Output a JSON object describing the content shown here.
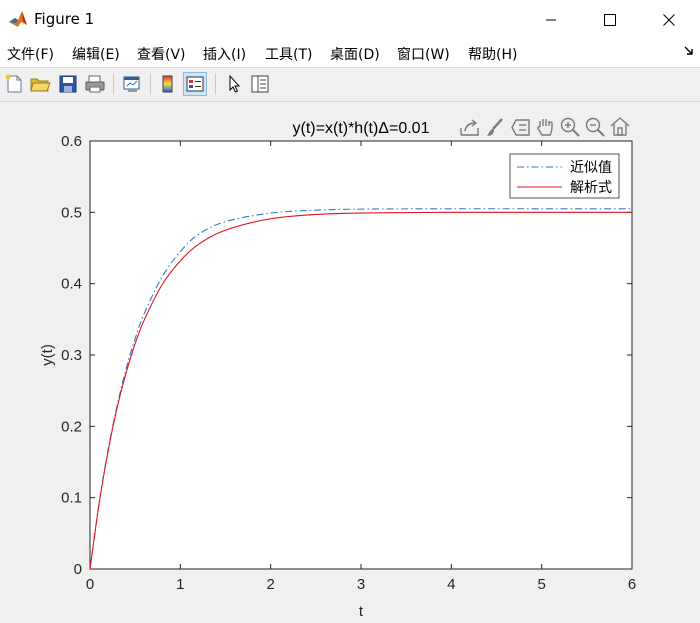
{
  "window": {
    "title": "Figure 1"
  },
  "menu": {
    "items": [
      "文件(F)",
      "编辑(E)",
      "查看(V)",
      "插入(I)",
      "工具(T)",
      "桌面(D)",
      "窗口(W)",
      "帮助(H)"
    ]
  },
  "toolbar": {
    "buttons": [
      "new-figure",
      "open-file",
      "save",
      "print",
      "link-plot",
      "insert-colorbar",
      "insert-legend",
      "edit-plot",
      "property-inspector"
    ]
  },
  "chart_data": {
    "type": "line",
    "title": "y(t)=x(t)*h(t)Δ=0.01",
    "xlabel": "t",
    "ylabel": "y(t)",
    "xlim": [
      0,
      6
    ],
    "ylim": [
      0,
      0.6
    ],
    "xticks": [
      "0",
      "1",
      "2",
      "3",
      "4",
      "5",
      "6"
    ],
    "yticks": [
      "0",
      "0.1",
      "0.2",
      "0.3",
      "0.4",
      "0.5",
      "0.6"
    ],
    "grid": false,
    "legend_position": "top-right",
    "series": [
      {
        "name": "近似值",
        "color": "#3a78c4",
        "style": "dash-dot",
        "x": [
          0,
          0.1,
          0.2,
          0.3,
          0.4,
          0.5,
          0.6,
          0.8,
          1.0,
          1.2,
          1.5,
          2.0,
          2.5,
          3.0,
          4.0,
          5.0,
          6.0
        ],
        "y": [
          0,
          0.091,
          0.167,
          0.229,
          0.281,
          0.323,
          0.358,
          0.41,
          0.445,
          0.469,
          0.487,
          0.499,
          0.503,
          0.5045,
          0.505,
          0.505,
          0.505
        ]
      },
      {
        "name": "解析式",
        "color": "#e0141e",
        "style": "solid",
        "x": [
          0,
          0.1,
          0.2,
          0.3,
          0.4,
          0.5,
          0.6,
          0.8,
          1.0,
          1.2,
          1.5,
          2.0,
          2.5,
          3.0,
          4.0,
          5.0,
          6.0
        ],
        "y": [
          0,
          0.091,
          0.165,
          0.226,
          0.275,
          0.316,
          0.349,
          0.399,
          0.432,
          0.455,
          0.475,
          0.491,
          0.497,
          0.499,
          0.5,
          0.5,
          0.5
        ]
      }
    ]
  }
}
